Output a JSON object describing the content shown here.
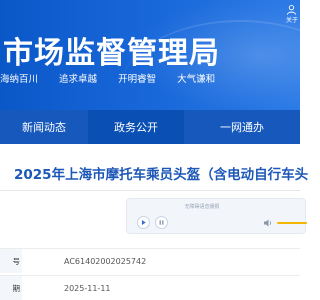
{
  "header": {
    "site_title": "市场监督管理局",
    "slogan": [
      "海纳百川",
      "追求卓越",
      "开明睿智",
      "大气谦和"
    ],
    "corner_link_label": "关于",
    "banner_color": "#1a69db"
  },
  "nav": {
    "items": [
      {
        "label": "新闻动态"
      },
      {
        "label": "政务公开"
      },
      {
        "label": "一网通办"
      }
    ],
    "color": "#0a4fb4"
  },
  "article": {
    "title": "2025年上海市摩托车乘员头盔（含电动自行车头",
    "title_color": "#1d58b8"
  },
  "player": {
    "caption": "无障碍语音播报",
    "play_icon": "play-icon",
    "pause_icon": "pause-icon",
    "volume_icon": "speaker-icon",
    "volume_color": "#f2b700"
  },
  "meta": {
    "rows": [
      {
        "key": "号",
        "value": "AC61402002025742"
      },
      {
        "key": "期",
        "value": "2025-11-11"
      }
    ]
  }
}
